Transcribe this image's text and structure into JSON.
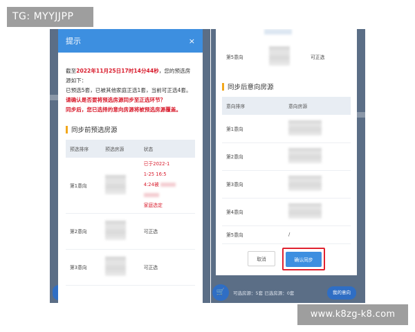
{
  "watermarks": {
    "top_left": "TG: MYYJJPP",
    "bottom_right": "www.k8zg-k8.com"
  },
  "left_dialog": {
    "title": "提示",
    "close_icon": "×",
    "notice_prefix": "截至",
    "notice_time": "2022年11月25日17时14分44秒",
    "notice_suffix": "，您的预选房源如下：",
    "notice_line2": "已预选5套，已被其他家庭正选1套，当前可正选4套。",
    "warn_line1": "请确认是否要将预选房源同步至正选环节？",
    "warn_line2": "同步后，您已选择的意向房源将被预选房源覆盖。",
    "section_title": "同步前预选房源",
    "columns": [
      "预选排序",
      "预选房源",
      "状态"
    ],
    "rows": [
      {
        "order": "第1意向",
        "status_line1": "已于2022-1",
        "status_line2": "1-25 16:5",
        "status_line3": "4:24被",
        "status_line4": "家庭选定"
      },
      {
        "order": "第2意向",
        "status": "可正选"
      },
      {
        "order": "第3意向",
        "status": "可正选"
      }
    ]
  },
  "right_dialog": {
    "top_row": {
      "order": "第5意向",
      "status": "可正选"
    },
    "section_title": "同步后意向房源",
    "columns": [
      "意向排序",
      "意向房源"
    ],
    "rows": [
      {
        "order": "第1意向",
        "value": ""
      },
      {
        "order": "第2意向",
        "value": ""
      },
      {
        "order": "第3意向",
        "value": ""
      },
      {
        "order": "第4意向",
        "value": ""
      },
      {
        "order": "第5意向",
        "value": "/"
      }
    ],
    "cancel_label": "取消",
    "confirm_label": "确认同步"
  },
  "bottom_bar": {
    "selectable_text": "可选房源：5套",
    "selected_text": "已选房源：0套",
    "mine_label": "我的意向"
  },
  "colors": {
    "accent_blue": "#3d8fe0",
    "warning_red": "#d8192a",
    "section_bar": "#f2a71b",
    "highlight_box": "#e0202e"
  }
}
